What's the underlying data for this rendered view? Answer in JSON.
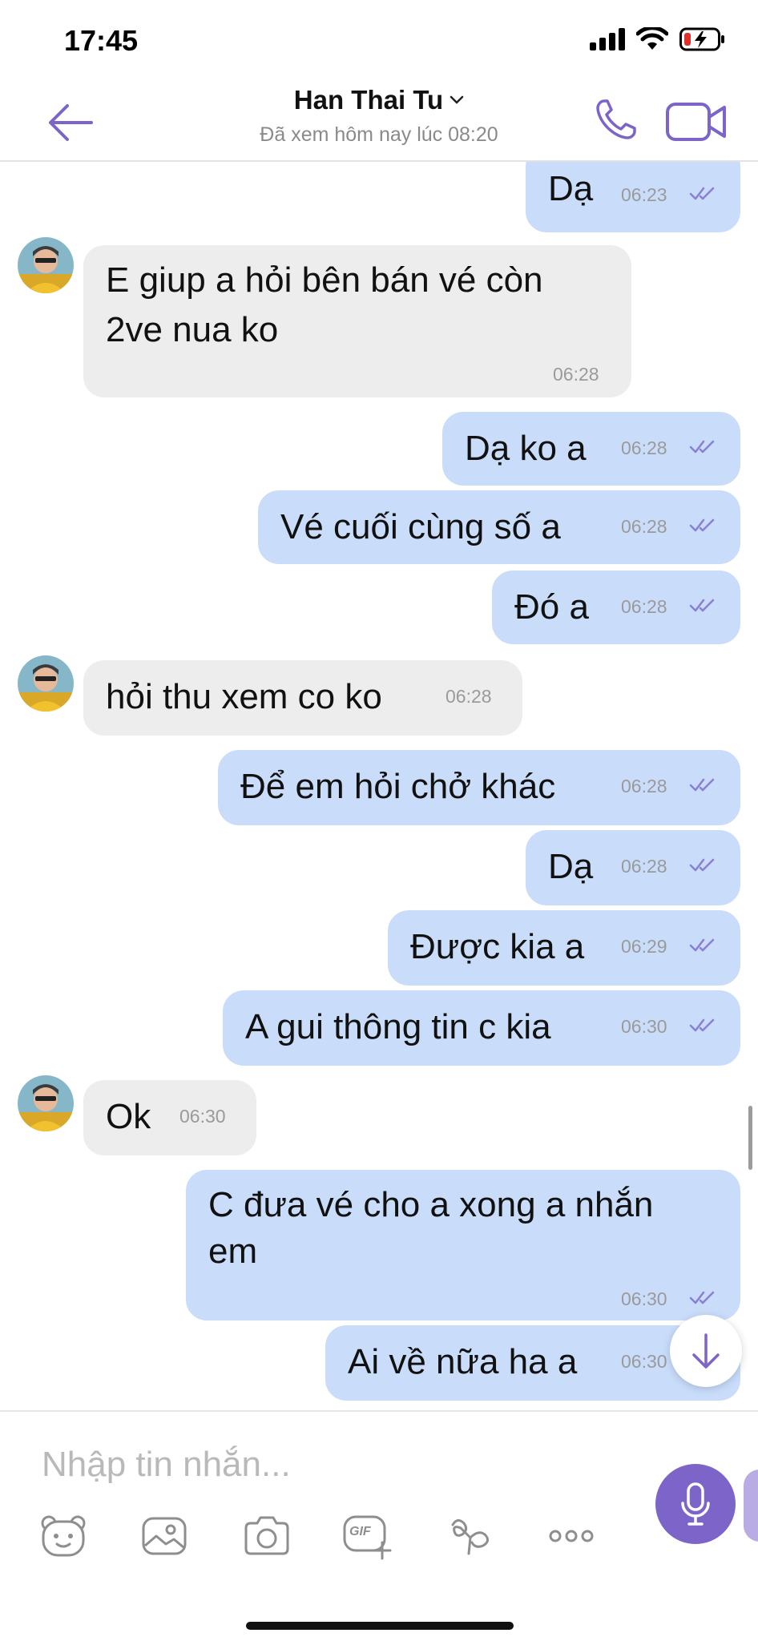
{
  "status_bar": {
    "time": "17:45"
  },
  "header": {
    "contact_name": "Han Thai Tu",
    "last_seen": "Đã xem hôm nay lúc 08:20"
  },
  "messages": [
    {
      "side": "out",
      "text": "Dạ",
      "time": "06:23"
    },
    {
      "side": "in",
      "text_lines": [
        "E giup a hỏi bên bán vé còn",
        "2ve nua ko"
      ],
      "time": "06:28"
    },
    {
      "side": "out",
      "text": "Dạ ko a",
      "time": "06:28"
    },
    {
      "side": "out",
      "text": "Vé cuối cùng số a",
      "time": "06:28"
    },
    {
      "side": "out",
      "text": "Đó a",
      "time": "06:28"
    },
    {
      "side": "in",
      "text": "hỏi thu xem co ko",
      "time": "06:28"
    },
    {
      "side": "out",
      "text": "Để em hỏi chở khác",
      "time": "06:28"
    },
    {
      "side": "out",
      "text": "Dạ",
      "time": "06:28"
    },
    {
      "side": "out",
      "text": "Được kia a",
      "time": "06:29"
    },
    {
      "side": "out",
      "text": "A gui thông tin c kia",
      "time": "06:30"
    },
    {
      "side": "in",
      "text": "Ok",
      "time": "06:30"
    },
    {
      "side": "out",
      "text_lines": [
        "C đưa vé cho a xong a nhắn",
        "em"
      ],
      "time": "06:30"
    },
    {
      "side": "out",
      "text": "Ai về nữa ha a",
      "time": "06:30"
    }
  ],
  "composer": {
    "placeholder": "Nhập tin nhắn...",
    "tools": [
      "sticker-icon",
      "gallery-icon",
      "camera-icon",
      "gif-icon",
      "doodle-icon",
      "more-icon"
    ],
    "gif_label": "GIF"
  },
  "colors": {
    "accent": "#7c64c9",
    "outgoing_bubble": "#c9ddfb",
    "incoming_bubble": "#ededed"
  }
}
